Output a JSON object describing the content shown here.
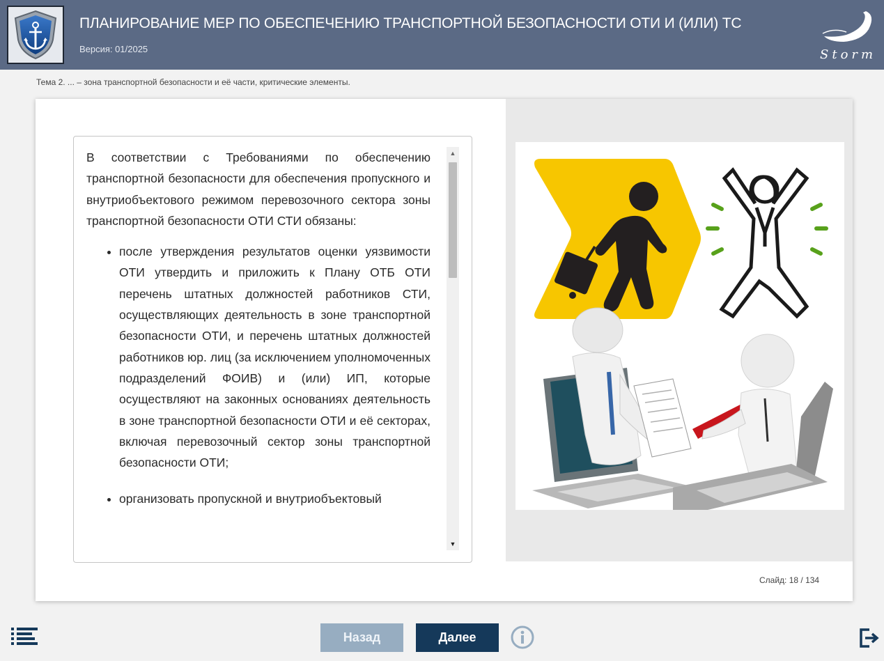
{
  "header": {
    "title": "ПЛАНИРОВАНИЕ МЕР ПО ОБЕСПЕЧЕНИЮ ТРАНСПОРТНОЙ БЕЗОПАСНОСТИ ОТИ И (ИЛИ) ТС",
    "version": "Версия: 01/2025",
    "logo_icon": "anchor-shield-icon",
    "brand_text": "Storm"
  },
  "topic": "Тема 2. ... – зона транспортной безопасности и её части, критические элементы.",
  "content": {
    "intro": "В соответствии с Требованиями по обеспечению транспортной безопасности для обеспечения пропускного и внутриобъектового режимом перевозочного сектора зоны транспортной безопасности ОТИ СТИ обязаны:",
    "bullets": [
      "после утверждения результатов оценки уязвимости ОТИ утвердить и приложить к Плану ОТБ ОТИ перечень штатных должностей работников СТИ, осуществляющих деятельность в зоне транспортной безопасности ОТИ, и перечень штатных должностей работников юр. лиц (за исключением уполномоченных подразделений ФОИВ) и (или) ИП, которые осуществляют на законных основаниях деятельность в зоне транспортной безопасности ОТИ и её секторах, включая перевозочный сектор зоны транспортной безопасности ОТИ;",
      "организовать пропускной и внутриобъектовый"
    ]
  },
  "illustration": {
    "icons": [
      "traveler-with-suitcase-icon",
      "security-person-icon",
      "laptop-document-exchange-illustration"
    ]
  },
  "slide_counter": "Слайд:  18 / 134",
  "navigation": {
    "back_label": "Назад",
    "next_label": "Далее",
    "menu_icon": "menu-list-icon",
    "info_icon": "info-icon",
    "exit_icon": "exit-icon"
  },
  "colors": {
    "header_bg": "#5b6a85",
    "next_button": "#15395a",
    "back_button": "#97adc1",
    "accent_yellow": "#f7c600",
    "accent_green": "#58a11b"
  }
}
